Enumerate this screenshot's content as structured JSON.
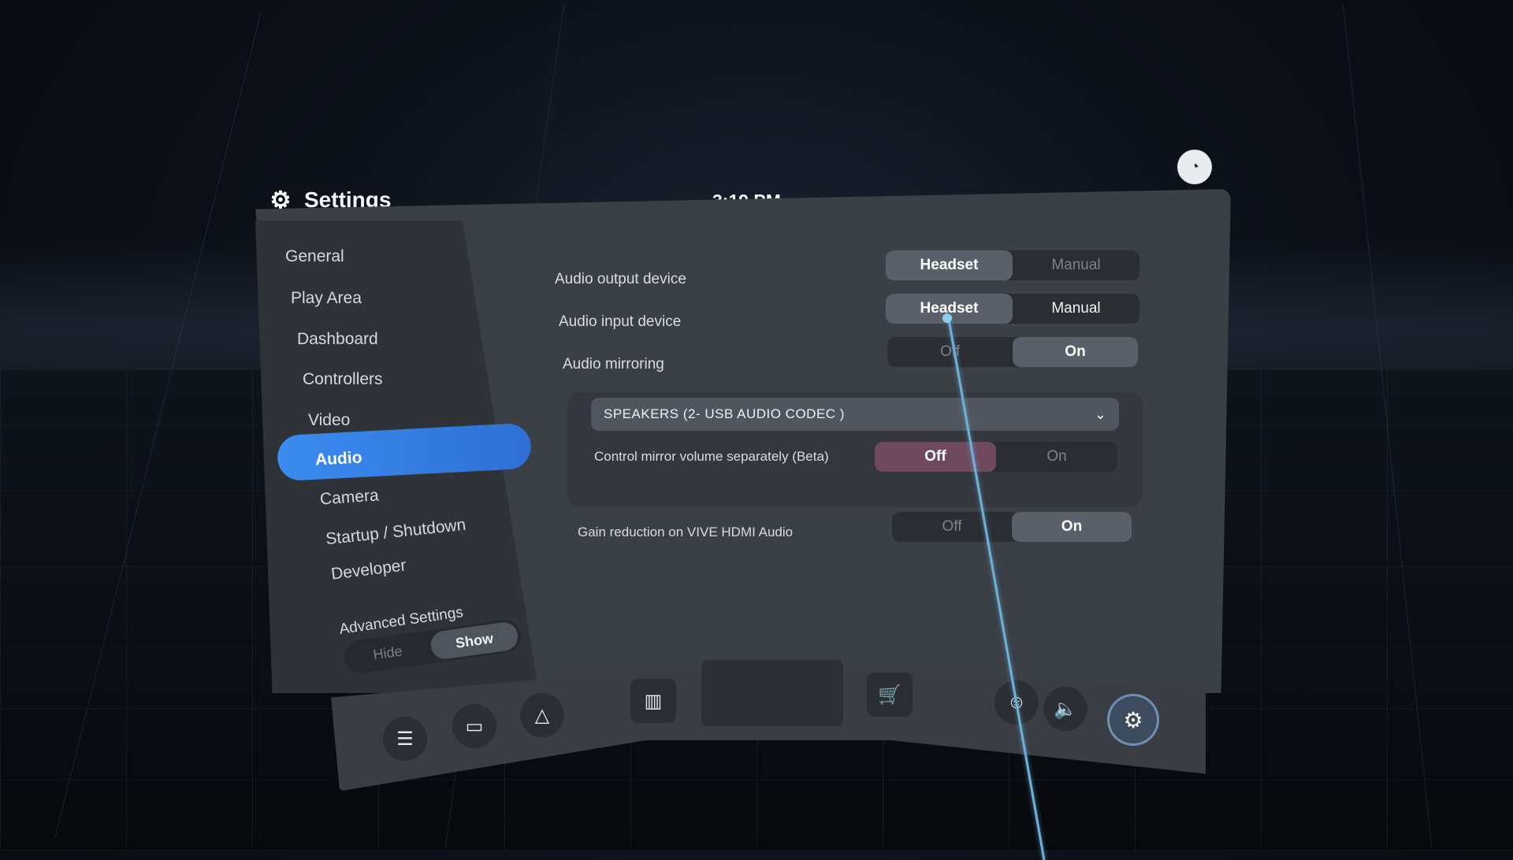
{
  "header": {
    "title": "Settings",
    "time": "3:19 PM"
  },
  "sidebar": {
    "items": [
      {
        "label": "General"
      },
      {
        "label": "Play Area"
      },
      {
        "label": "Dashboard"
      },
      {
        "label": "Controllers"
      },
      {
        "label": "Video"
      },
      {
        "label": "Audio",
        "active": true
      },
      {
        "label": "Camera"
      },
      {
        "label": "Startup / Shutdown"
      },
      {
        "label": "Developer"
      }
    ],
    "advanced": {
      "label": "Advanced Settings",
      "options": [
        "Hide",
        "Show"
      ],
      "selected": "Show"
    }
  },
  "audio": {
    "output_device": {
      "label": "Audio output device",
      "options": [
        "Headset",
        "Manual"
      ],
      "selected": "Headset"
    },
    "input_device": {
      "label": "Audio input device",
      "options": [
        "Headset",
        "Manual"
      ],
      "selected": "Headset"
    },
    "mirroring": {
      "label": "Audio mirroring",
      "options": [
        "Off",
        "On"
      ],
      "selected": "On"
    },
    "mirror_device": "SPEAKERS (2- USB AUDIO CODEC )",
    "mirror_volume": {
      "label": "Control mirror volume separately (Beta)",
      "options": [
        "Off",
        "On"
      ],
      "selected": "Off"
    },
    "gain_reduction": {
      "label": "Gain reduction on VIVE HDMI Audio",
      "options": [
        "Off",
        "On"
      ],
      "selected": "On"
    }
  },
  "colors": {
    "accent": "#3b8cf0",
    "status_dots": "#4ce06a",
    "off_highlight": "#6f4a5e"
  },
  "icons": [
    "gear-icon",
    "steam-icon",
    "menu-icon",
    "window-icon",
    "vive-icon",
    "library-icon",
    "store-icon",
    "people-icon",
    "volume-icon",
    "settings-icon"
  ]
}
